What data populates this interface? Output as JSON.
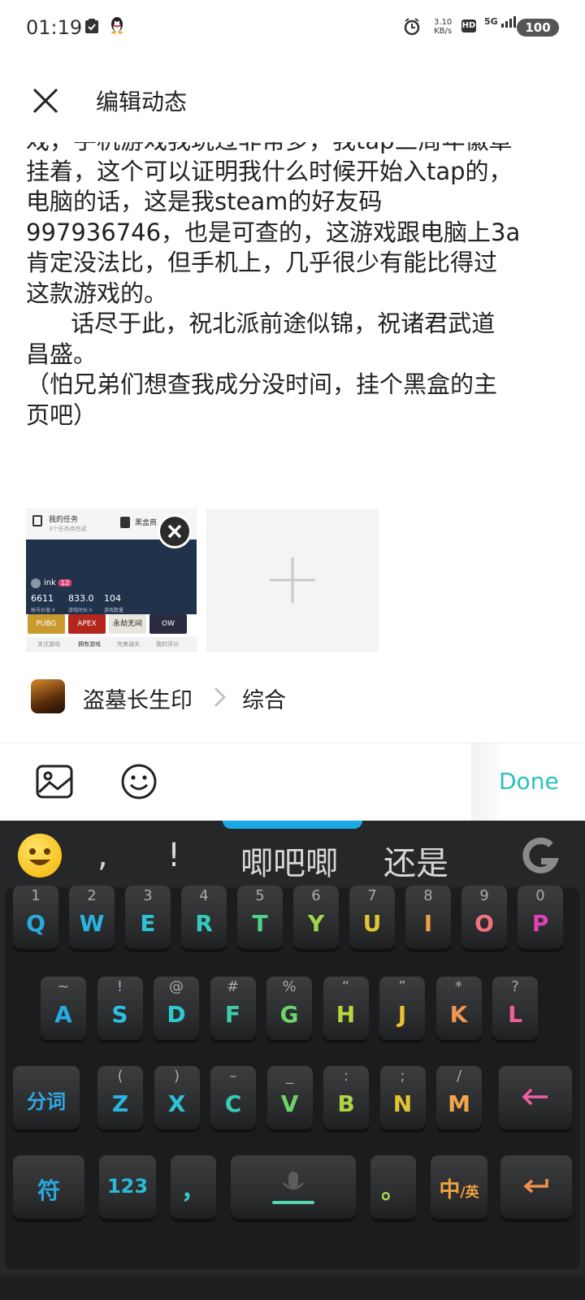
{
  "status_bar": {
    "time": "01:19",
    "net_speed_value": "3.10",
    "net_speed_unit": "KB/s",
    "hd": "HD",
    "network": "5G",
    "battery": "100"
  },
  "header": {
    "title": "编辑动态"
  },
  "post": {
    "lines": [
      "戏，手机游戏我玩过非常多，我tap三周年徽章",
      "挂着，这个可以证明我什么时候开始入tap的，",
      "电脑的话，这是我steam的好友码",
      "997936746，也是可查的，这游戏跟电脑上3a",
      "肯定没法比，但手机上，几乎很少有能比得过",
      "这款游戏的。",
      "      话尽于此，祝北派前途似锦，祝诸君武道",
      "昌盛。",
      "（怕兄弟们想查我成分没时间，挂个黑盒的主",
      "页吧）"
    ]
  },
  "attachment": {
    "my_tasks": "我的任务",
    "tasks_sub": "3个任务待完成",
    "heibox": "黑盒商",
    "username": "ink",
    "level": "12",
    "stats": [
      {
        "value": "6611",
        "label": "账号价值 ¥"
      },
      {
        "value": "833.0",
        "label": "游戏时长 h"
      },
      {
        "value": "104",
        "label": "游戏数量"
      }
    ],
    "game_tiles": [
      "PUBG",
      "APEX",
      "永劫无间",
      "OW"
    ],
    "tabs": [
      "关注游戏",
      "拥有游戏",
      "完美通关",
      "我的评分"
    ]
  },
  "game_tag": {
    "game": "盗墓长生印",
    "category": "综合"
  },
  "toolbar": {
    "done": "Done"
  },
  "keyboard": {
    "candidates": [
      ",",
      "!",
      "唧吧唧",
      "还是"
    ],
    "row1": [
      {
        "sub": "1",
        "key": "Q",
        "color": "#27a9e1"
      },
      {
        "sub": "2",
        "key": "W",
        "color": "#29b3e0"
      },
      {
        "sub": "3",
        "key": "E",
        "color": "#2ec0d5"
      },
      {
        "sub": "4",
        "key": "R",
        "color": "#36c9c2"
      },
      {
        "sub": "5",
        "key": "T",
        "color": "#4fd18d"
      },
      {
        "sub": "6",
        "key": "Y",
        "color": "#9fd54a"
      },
      {
        "sub": "7",
        "key": "U",
        "color": "#e3c432"
      },
      {
        "sub": "8",
        "key": "I",
        "color": "#f0a045"
      },
      {
        "sub": "9",
        "key": "O",
        "color": "#f2727f"
      },
      {
        "sub": "0",
        "key": "P",
        "color": "#e23fb8"
      }
    ],
    "row2": [
      {
        "sub": "~",
        "key": "A",
        "color": "#27a9e1"
      },
      {
        "sub": "!",
        "key": "S",
        "color": "#2ebee0"
      },
      {
        "sub": "@",
        "key": "D",
        "color": "#2ec7d2"
      },
      {
        "sub": "#",
        "key": "F",
        "color": "#3fcda9"
      },
      {
        "sub": "%",
        "key": "G",
        "color": "#6bd46b"
      },
      {
        "sub": "“",
        "key": "H",
        "color": "#b9d540"
      },
      {
        "sub": "”",
        "key": "J",
        "color": "#e7c233"
      },
      {
        "sub": "*",
        "key": "K",
        "color": "#f0974f"
      },
      {
        "sub": "?",
        "key": "L",
        "color": "#ee5f97"
      }
    ],
    "row3": [
      {
        "sub": "(",
        "key": "Z",
        "color": "#27b6e2"
      },
      {
        "sub": ")",
        "key": "X",
        "color": "#2ec4d5"
      },
      {
        "sub": "–",
        "key": "C",
        "color": "#39cbb5"
      },
      {
        "sub": "_",
        "key": "V",
        "color": "#6dd36a"
      },
      {
        "sub": ":",
        "key": "B",
        "color": "#aed444"
      },
      {
        "sub": ";",
        "key": "N",
        "color": "#e0c530"
      },
      {
        "sub": "/",
        "key": "M",
        "color": "#f2a64a"
      }
    ],
    "fenci": "分词",
    "fu": "符",
    "num": "123",
    "comma": "，",
    "period": "。",
    "zh": "中",
    "en": "/英",
    "colors": {
      "fenci": "#2ea8e6",
      "fu": "#27a9e1",
      "num": "#2bbad9",
      "comma": "#37c9c4",
      "space_bar": "#56d3b0",
      "period": "#a7d34a",
      "zh": "#f0a040",
      "backspace": "#ee5ea4",
      "enter": "#f08f4a"
    }
  }
}
